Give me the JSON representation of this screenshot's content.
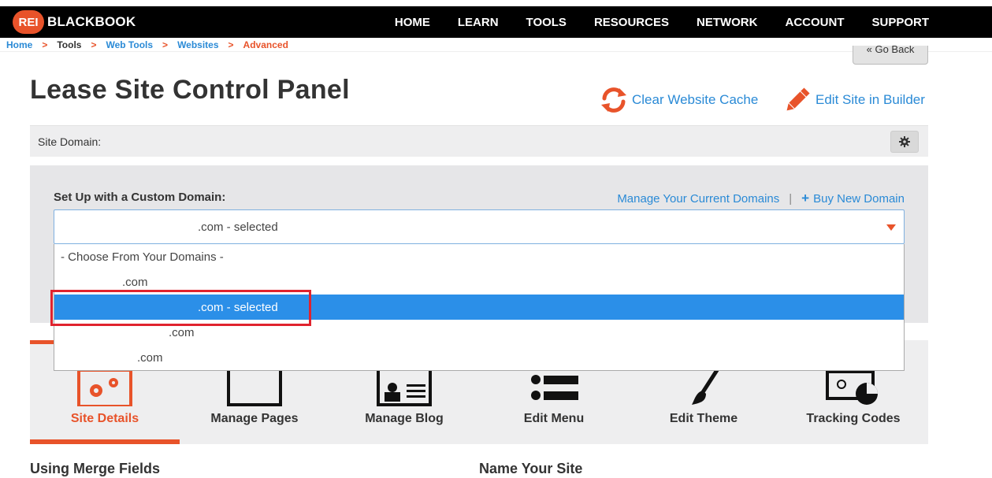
{
  "brand": {
    "badge": "REI",
    "name": "BLACKBOOK"
  },
  "nav": [
    "HOME",
    "LEARN",
    "TOOLS",
    "RESOURCES",
    "NETWORK",
    "ACCOUNT",
    "SUPPORT"
  ],
  "breadcrumb": {
    "home": "Home",
    "tools": "Tools",
    "web_tools": "Web Tools",
    "websites": "Websites",
    "advanced": "Advanced",
    "sep": ">"
  },
  "go_back": "« Go Back",
  "page": {
    "title": "Lease Site Control Panel"
  },
  "actions": {
    "clear_cache": "Clear Website Cache",
    "edit_builder": "Edit Site in Builder"
  },
  "domain_bar": {
    "label": "Site Domain:"
  },
  "custom_domain": {
    "label": "Set Up with a Custom Domain:",
    "manage_link": "Manage Your Current Domains",
    "pipe": "|",
    "plus": "+",
    "buy_link": "Buy New Domain",
    "selected_value": ".com - selected",
    "options": [
      "- Choose From Your Domains -",
      ".com",
      ".com - selected",
      ".com",
      ".com"
    ]
  },
  "tabs": [
    "Site Details",
    "Manage Pages",
    "Manage Blog",
    "Edit Menu",
    "Edit Theme",
    "Tracking Codes"
  ],
  "sections": {
    "merge_fields": "Using Merge Fields",
    "name_site": "Name Your Site"
  },
  "colors": {
    "accent": "#e8532a",
    "link": "#2a8ad6",
    "selected": "#2b8fe8",
    "highlight": "#e0232e"
  }
}
